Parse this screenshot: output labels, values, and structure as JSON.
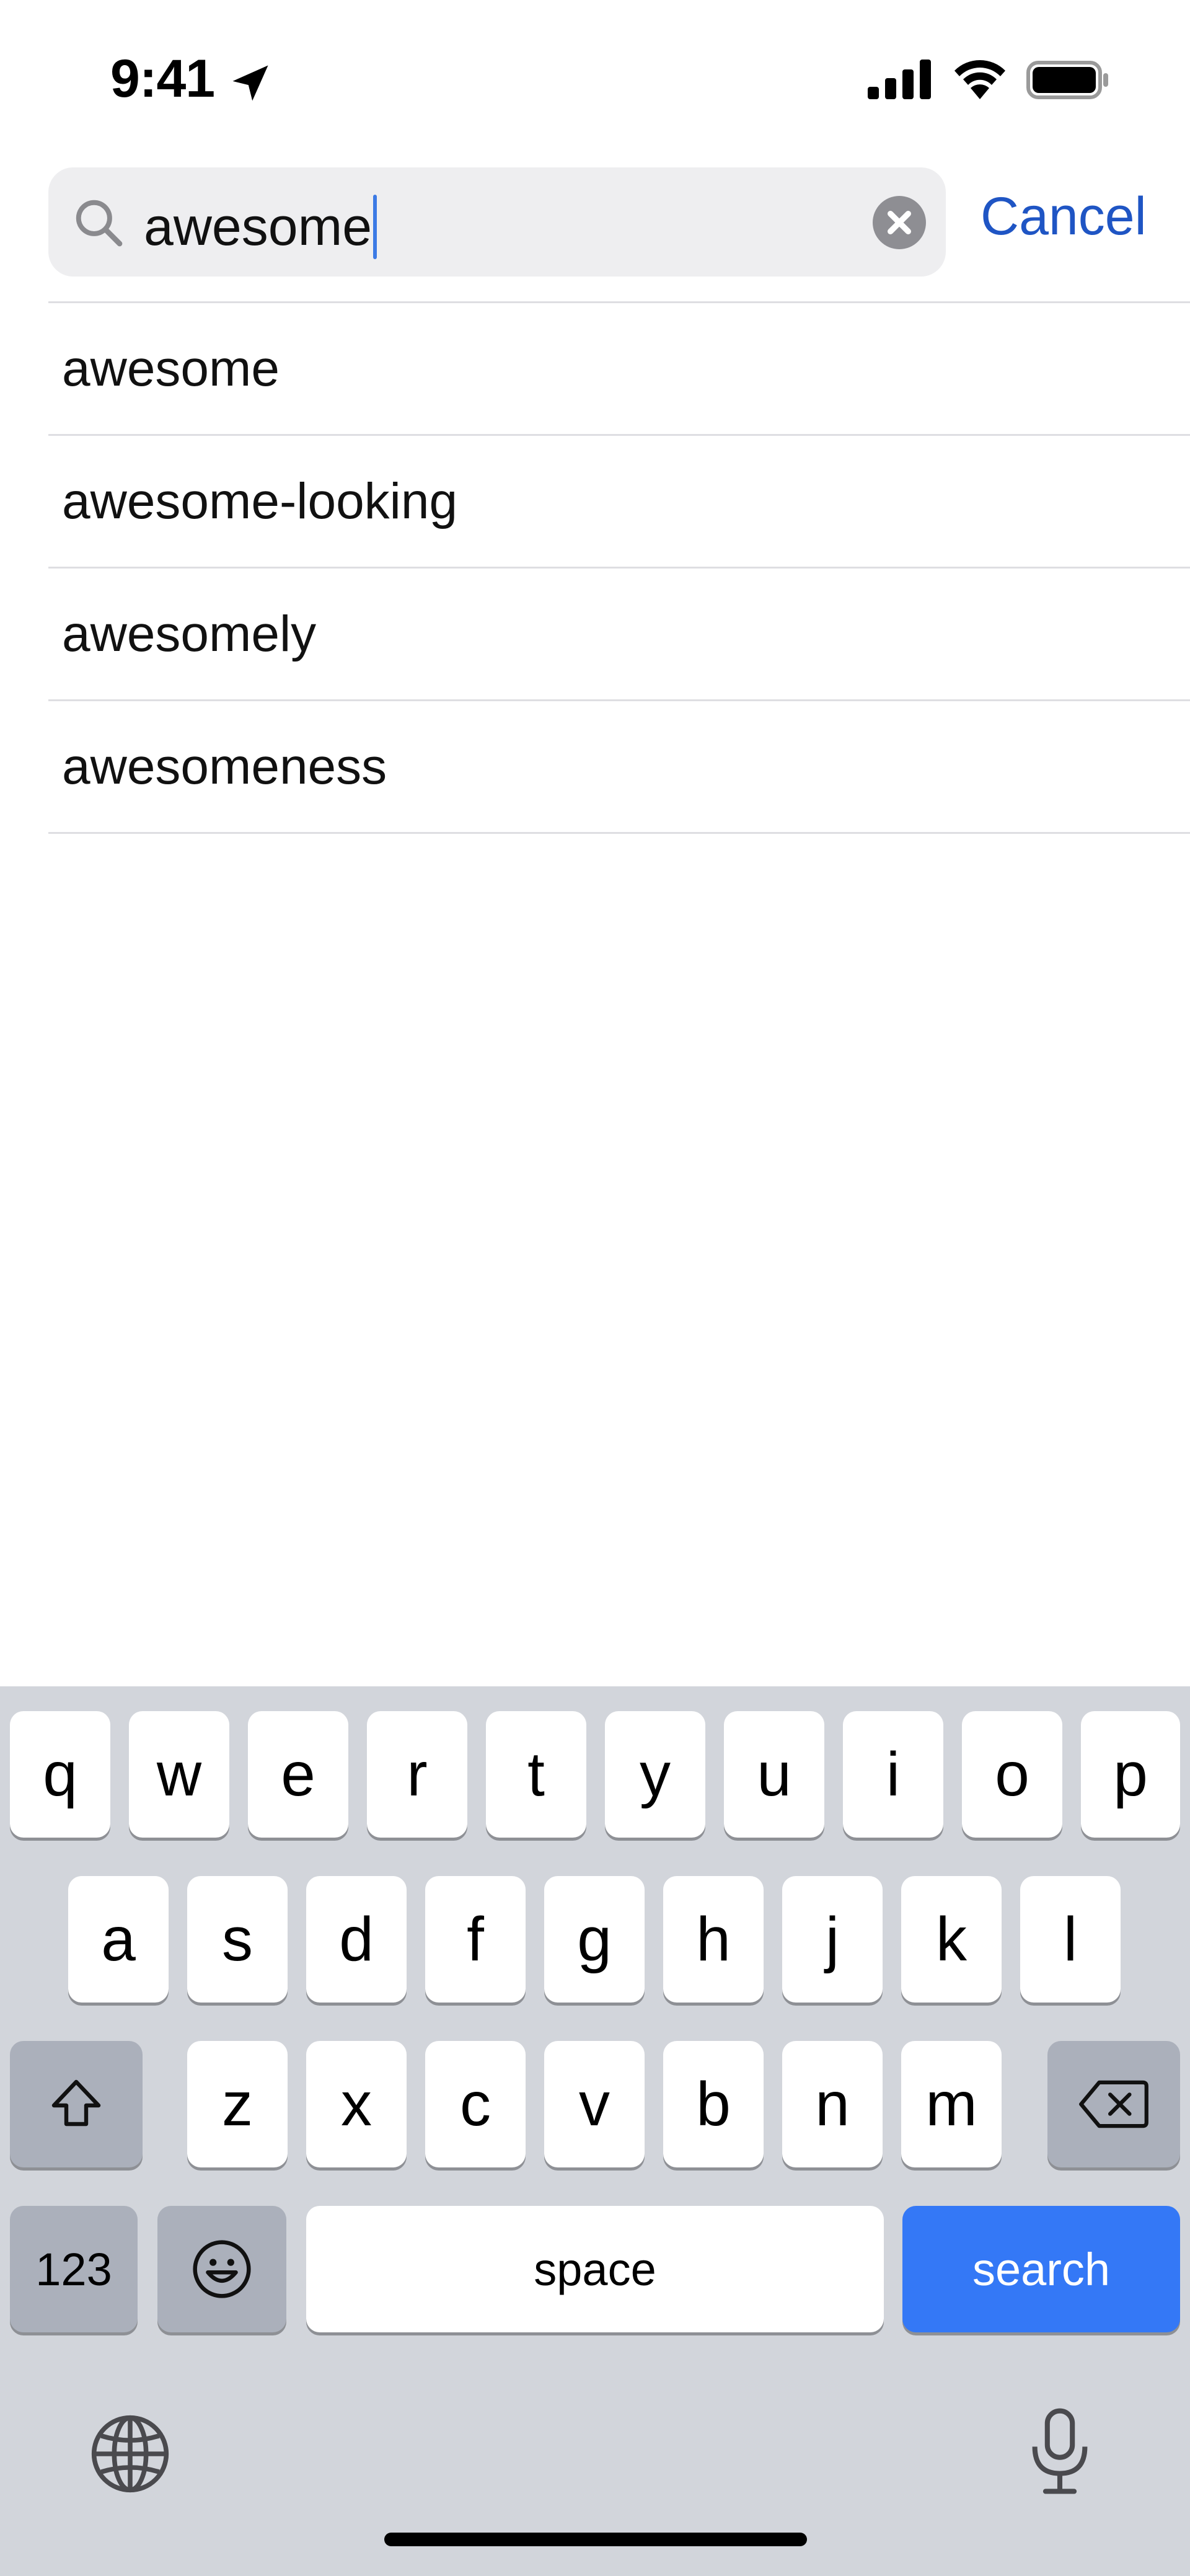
{
  "status_bar": {
    "time": "9:41"
  },
  "search": {
    "query": "awesome",
    "cancel_label": "Cancel"
  },
  "suggestions": [
    "awesome",
    "awesome-looking",
    "awesomely",
    "awesomeness"
  ],
  "keyboard": {
    "row1": [
      "q",
      "w",
      "e",
      "r",
      "t",
      "y",
      "u",
      "i",
      "o",
      "p"
    ],
    "row2": [
      "a",
      "s",
      "d",
      "f",
      "g",
      "h",
      "j",
      "k",
      "l"
    ],
    "row3": [
      "z",
      "x",
      "c",
      "v",
      "b",
      "n",
      "m"
    ],
    "numbers_label": "123",
    "space_label": "space",
    "search_label": "search"
  },
  "colors": {
    "accent": "#1f55c4",
    "search_key": "#3478f6",
    "keyboard_bg": "#d2d5db",
    "field_bg": "#eeeef0"
  }
}
